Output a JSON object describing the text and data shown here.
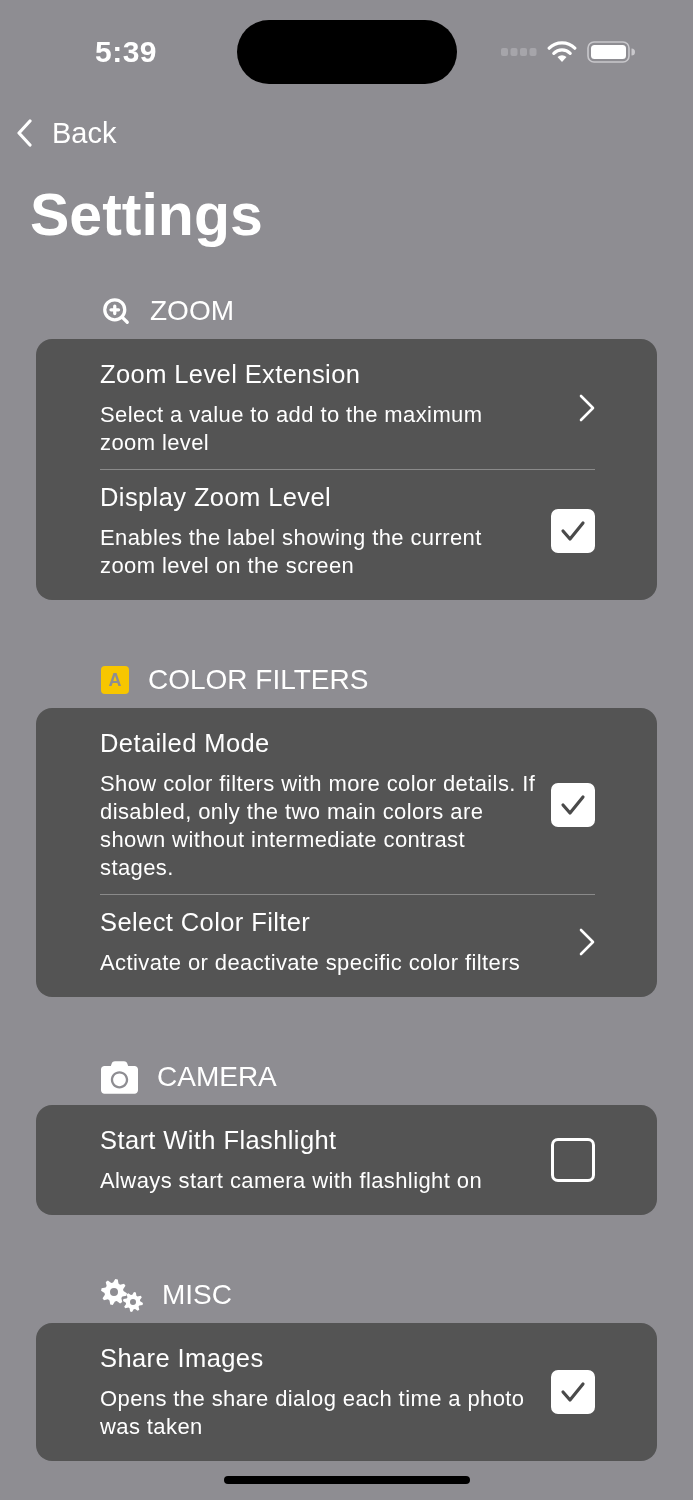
{
  "status_bar": {
    "time": "5:39"
  },
  "nav": {
    "back": "Back"
  },
  "title": "Settings",
  "sections": [
    {
      "header": "ZOOM",
      "rows": [
        {
          "kind": "link",
          "title": "Zoom Level Extension",
          "description": "Select a value to add to the maximum zoom level"
        },
        {
          "kind": "checkbox",
          "title": "Display Zoom Level",
          "description": "Enables the label showing the current zoom level on the screen",
          "checked": true
        }
      ]
    },
    {
      "header": "COLOR FILTERS",
      "badge": "A",
      "rows": [
        {
          "kind": "checkbox",
          "title": "Detailed Mode",
          "description": "Show color filters with more color details. If disabled, only the two main colors are shown without intermediate contrast stages.",
          "checked": true
        },
        {
          "kind": "link",
          "title": "Select Color Filter",
          "description": "Activate or deactivate specific color filters"
        }
      ]
    },
    {
      "header": "CAMERA",
      "rows": [
        {
          "kind": "checkbox",
          "title": "Start With Flashlight",
          "description": "Always start camera with flashlight on",
          "checked": false
        }
      ]
    },
    {
      "header": "MISC",
      "rows": [
        {
          "kind": "checkbox",
          "title": "Share Images",
          "description": "Opens the share dialog each time a photo was taken",
          "checked": true
        }
      ]
    }
  ]
}
